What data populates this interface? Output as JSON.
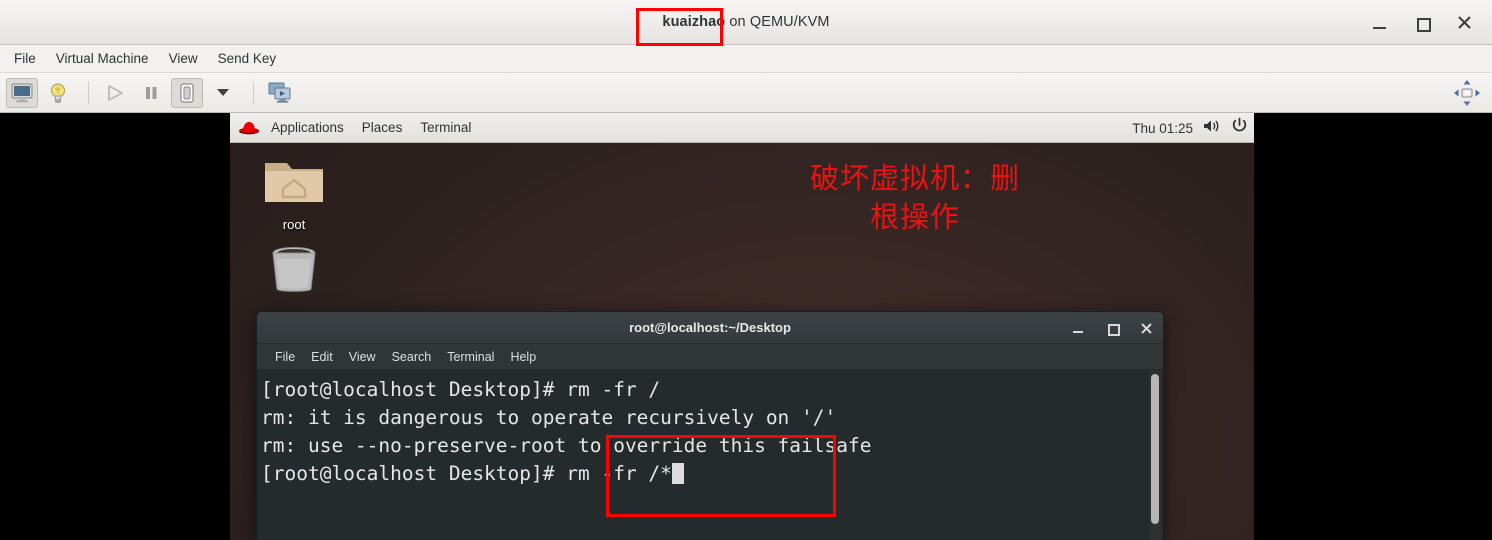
{
  "window": {
    "title_bold": "kuaizhao",
    "title_rest": " on QEMU/KVM",
    "controls": {
      "minimize": "–",
      "maximize": "□",
      "close": "✕"
    }
  },
  "menubar": {
    "items": [
      {
        "label": "File"
      },
      {
        "label": "Virtual Machine"
      },
      {
        "label": "View"
      },
      {
        "label": "Send Key"
      }
    ]
  },
  "toolbar": {
    "buttons": [
      {
        "name": "console-view",
        "icon": "monitor-icon"
      },
      {
        "name": "details-view",
        "icon": "lightbulb-icon"
      },
      {
        "name": "run",
        "icon": "play-icon"
      },
      {
        "name": "pause",
        "icon": "pause-icon"
      },
      {
        "name": "shutdown",
        "icon": "shutdown-icon"
      },
      {
        "name": "shutdown-menu",
        "icon": "chevron-down-icon"
      },
      {
        "name": "snapshots",
        "icon": "screens-icon"
      }
    ],
    "fullscreen_icon": "fullscreen-icon"
  },
  "guest": {
    "panel": {
      "logo": "redhat-logo",
      "items": [
        {
          "label": "Applications"
        },
        {
          "label": "Places"
        },
        {
          "label": "Terminal"
        }
      ],
      "clock": "Thu 01:25",
      "volume_icon": "volume-icon",
      "power_icon": "power-icon"
    },
    "desktop": {
      "icons": [
        {
          "label": "root",
          "icon": "home-folder-icon"
        },
        {
          "label": "",
          "icon": "trash-icon"
        }
      ],
      "warning_line1": "破坏虚拟机：删",
      "warning_line2": "根操作",
      "warning_color": "#ee1111"
    },
    "terminal": {
      "title": "root@localhost:~/Desktop",
      "menu": [
        {
          "label": "File"
        },
        {
          "label": "Edit"
        },
        {
          "label": "View"
        },
        {
          "label": "Search"
        },
        {
          "label": "Terminal"
        },
        {
          "label": "Help"
        }
      ],
      "lines": [
        "[root@localhost Desktop]# rm -fr /",
        "rm: it is dangerous to operate recursively on '/'",
        "rm: use --no-preserve-root to override this failsafe"
      ],
      "prompt": "[root@localhost Desktop]# ",
      "current_command": "rm -fr /*",
      "controls": {
        "minimize": "–",
        "maximize": "□",
        "close": "✕"
      }
    }
  },
  "annotations": [
    {
      "name": "annot-title",
      "target": "kuaizhao",
      "color": "#ff0000"
    },
    {
      "name": "annot-command",
      "target": "rm -fr /*",
      "color": "#ff0000"
    }
  ]
}
